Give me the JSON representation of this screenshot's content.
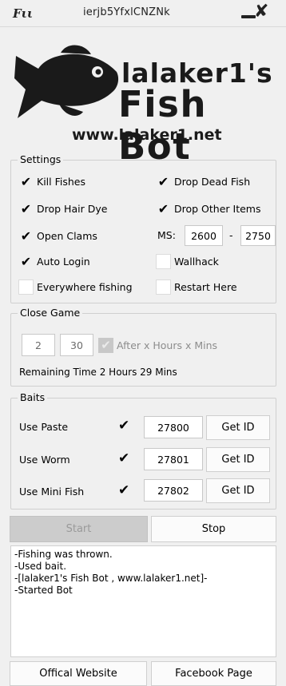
{
  "window": {
    "icon_text": "Fιι",
    "title": "ierjb5YfxlCNZNk",
    "minimize_glyph": "—",
    "close_glyph": "✘"
  },
  "logo": {
    "line1": "lalaker1's",
    "line2": "Fish Bot",
    "line3": "www.lalaker1.net"
  },
  "settings": {
    "title": "Settings",
    "kill_fishes": {
      "label": "Kill Fishes",
      "checked": true
    },
    "drop_dead_fish": {
      "label": "Drop Dead Fish",
      "checked": true
    },
    "drop_hair_dye": {
      "label": "Drop Hair Dye",
      "checked": true
    },
    "drop_other_items": {
      "label": "Drop Other Items",
      "checked": true
    },
    "open_clams": {
      "label": "Open Clams",
      "checked": true
    },
    "ms_label": "MS:",
    "ms_min": "2600",
    "ms_dash": "-",
    "ms_max": "2750",
    "auto_login": {
      "label": "Auto Login",
      "checked": true
    },
    "wallhack": {
      "label": "Wallhack",
      "checked": false
    },
    "everywhere_fishing": {
      "label": "Everywhere fishing",
      "checked": false
    },
    "restart_here": {
      "label": "Restart Here",
      "checked": false
    }
  },
  "close_game": {
    "title": "Close Game",
    "hours": "2",
    "mins": "30",
    "after_label": "After x Hours x Mins",
    "after_checked": true,
    "remaining": "Remaining Time 2 Hours 29 Mins"
  },
  "baits": {
    "title": "Baits",
    "items": [
      {
        "label": "Use Paste",
        "checked": true,
        "id": "27800",
        "button": "Get ID"
      },
      {
        "label": "Use Worm",
        "checked": true,
        "id": "27801",
        "button": "Get ID"
      },
      {
        "label": "Use Mini Fish",
        "checked": true,
        "id": "27802",
        "button": "Get ID"
      }
    ]
  },
  "controls": {
    "start": "Start",
    "stop": "Stop"
  },
  "log": [
    "-Fishing was thrown.",
    "-Used bait.",
    "-[lalaker1's Fish Bot , www.lalaker1.net]-",
    "-Started Bot"
  ],
  "footer": {
    "website": "Offical Website",
    "facebook": "Facebook Page"
  },
  "colors": {
    "background": "#f0f0f0",
    "disabled_button": "#cccccc",
    "text": "#000000"
  }
}
